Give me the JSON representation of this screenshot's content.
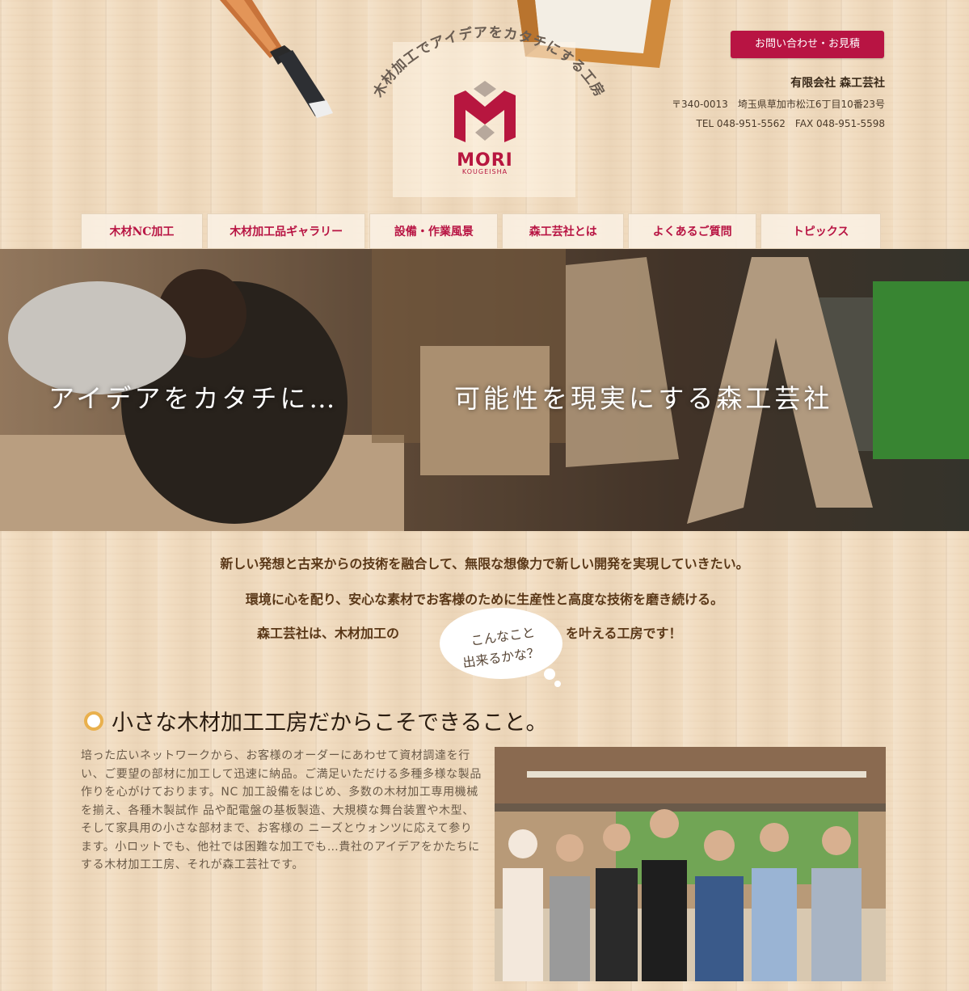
{
  "header": {
    "tagline": "木材加工でアイデアをカタチにする工房",
    "logo_name": "MORI",
    "logo_sub": "KOUGEISHA",
    "contact_button": "お問い合わせ・お見積",
    "company_name": "有限会社 森工芸社",
    "address": "〒340-0013　埼玉県草加市松江6丁目10番23号",
    "tel_fax": "TEL 048-951-5562　FAX 048-951-5598"
  },
  "nav": {
    "items": [
      "木材NC加工",
      "木材加工品ギャラリー",
      "設備・作業風景",
      "森工芸社とは",
      "よくあるご質問",
      "トピックス"
    ]
  },
  "hero": {
    "caption_left": "アイデアをカタチに…",
    "caption_right": "可能性を現実にする森工芸社"
  },
  "intro": {
    "line1": "新しい発想と古来からの技術を融合して、無限な想像力で新しい開発を実現していきたい。",
    "line2": "環境に心を配り、安心な素材でお客様のために生産性と高度な技術を磨き続ける。",
    "line3_before": "森工芸社は、木材加工の",
    "line3_after": "を叶える工房です！",
    "bubble_line1": "こんなこと",
    "bubble_line2": "出来るかな？"
  },
  "section": {
    "title": "小さな木材加工工房だからこそできること。",
    "body": "培った広いネットワークから、お客様のオーダーにあわせて資材調達を行い、ご要望の部材に加工して迅速に納品。ご満足いただける多種多様な製品 作りを心がけております。NC 加工設備をはじめ、多数の木材加工専用機械を揃え、各種木製試作 品や配電盤の基板製造、大規模な舞台装置や木型、そして家具用の小さな部材まで、お客様の ニーズとウォンツに応えて参ります。小ロットでも、他社では困難な加工でも…貴社のアイデアをかたちにする木材加工工房、それが森工芸社です。"
  },
  "colors": {
    "accent": "#b81443",
    "bullet": "#e9b04d",
    "wood": "#f1dcc0"
  }
}
